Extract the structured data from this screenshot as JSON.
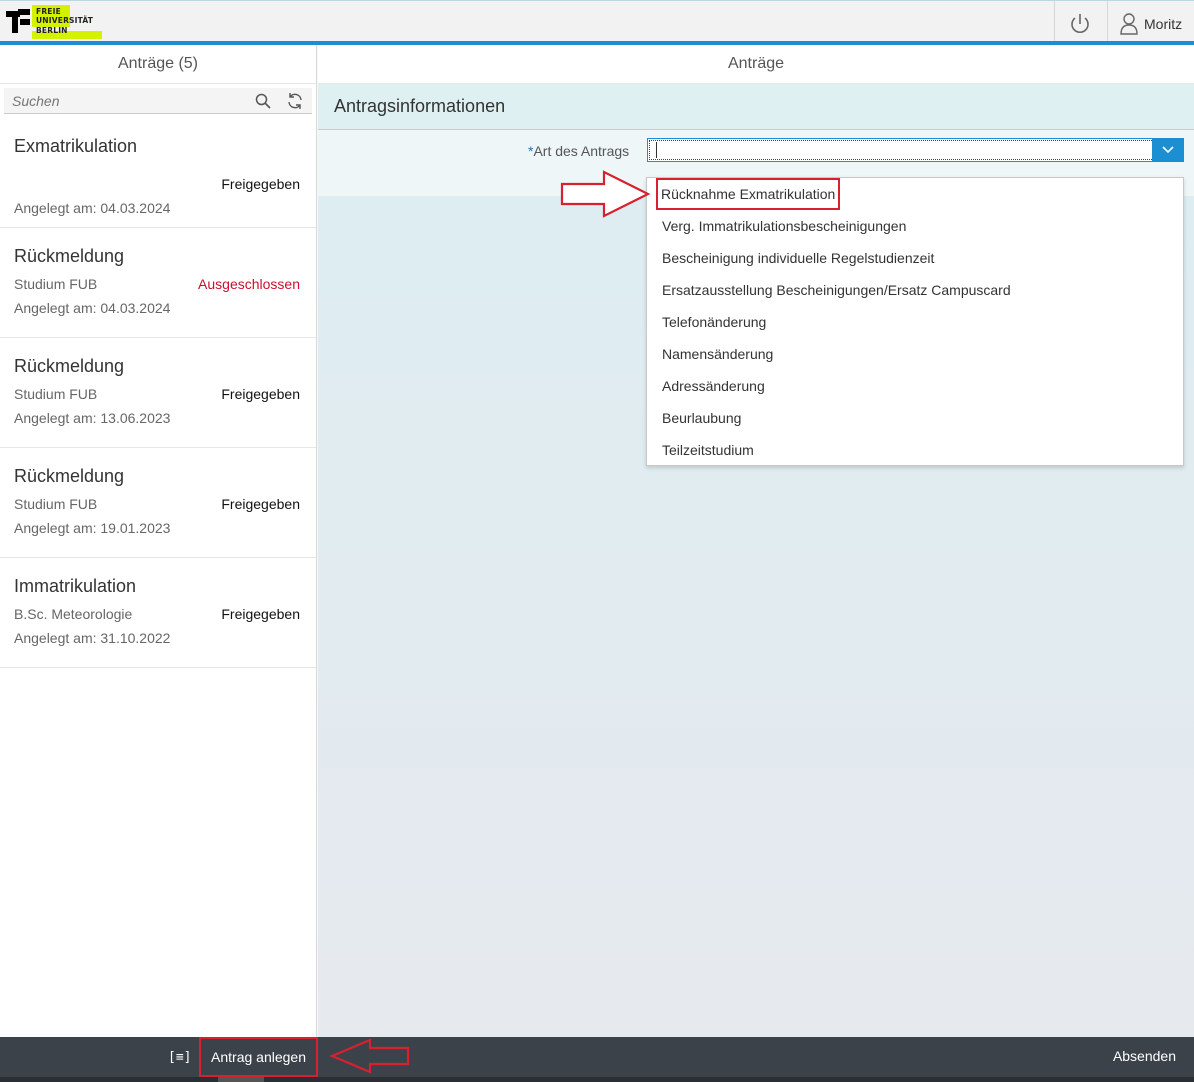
{
  "logo": {
    "line1": "FREIE",
    "line2": "UNIVERSITÄT",
    "line3": "BERLIN",
    "accent": "#d4f200"
  },
  "shell": {
    "user_name": "Moritz"
  },
  "master": {
    "title": "Anträge (5)",
    "search_placeholder": "Suchen",
    "items": [
      {
        "title": "Exmatrikulation",
        "sub": "",
        "status": "Freigegeben",
        "status_type": "ok",
        "date": "Angelegt am: 04.03.2024"
      },
      {
        "title": "Rückmeldung",
        "sub": "Studium FUB",
        "status": "Ausgeschlossen",
        "status_type": "error",
        "date": "Angelegt am: 04.03.2024"
      },
      {
        "title": "Rückmeldung",
        "sub": "Studium FUB",
        "status": "Freigegeben",
        "status_type": "ok",
        "date": "Angelegt am: 13.06.2023"
      },
      {
        "title": "Rückmeldung",
        "sub": "Studium FUB",
        "status": "Freigegeben",
        "status_type": "ok",
        "date": "Angelegt am: 19.01.2023"
      },
      {
        "title": "Immatrikulation",
        "sub": "B.Sc. Meteorologie",
        "status": "Freigegeben",
        "status_type": "ok",
        "date": "Angelegt am: 31.10.2022"
      }
    ]
  },
  "detail": {
    "title": "Anträge",
    "section": "Antragsinformationen",
    "field_label": "Art des Antrags",
    "required_mark": "*",
    "field_value": "",
    "options": [
      "Rücknahme Exmatrikulation",
      "Verg. Immatrikulationsbescheinigungen",
      "Bescheinigung individuelle Regelstudienzeit",
      "Ersatzausstellung Bescheinigungen/Ersatz Campuscard",
      "Telefonänderung",
      "Namensänderung",
      "Adressänderung",
      "Beurlaubung",
      "Teilzeitstudium"
    ]
  },
  "footer": {
    "list_icon": "[≡]",
    "create_label": "Antrag anlegen",
    "submit_label": "Absenden"
  },
  "colors": {
    "accent_blue": "#1b8fd2",
    "annotation_red": "#d7212e",
    "error_red": "#c8102e",
    "footer_bg": "#3c4249"
  }
}
